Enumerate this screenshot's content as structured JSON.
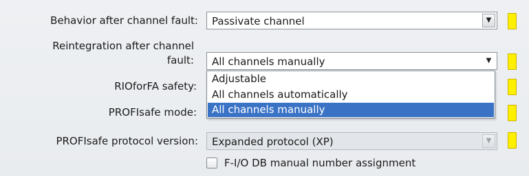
{
  "rows": [
    {
      "label": "Behavior after channel fault:",
      "value": "Passivate channel"
    },
    {
      "label_line1": "Reintegration after channel",
      "label_line2": "fault:",
      "value": "All channels manually"
    },
    {
      "label": "RIOforFA safety:"
    },
    {
      "label": "PROFIsafe mode:"
    },
    {
      "label": "PROFIsafe protocol version:",
      "value": "Expanded protocol (XP)"
    }
  ],
  "dropdown_options": [
    "Adjustable",
    "All channels automatically",
    "All channels manually"
  ],
  "selected_option": "All channels manually",
  "checkbox": {
    "label": "F-I/O DB manual number assignment",
    "checked": false
  },
  "colors": {
    "marker": "#ffef00",
    "selection": "#3a73c6"
  }
}
